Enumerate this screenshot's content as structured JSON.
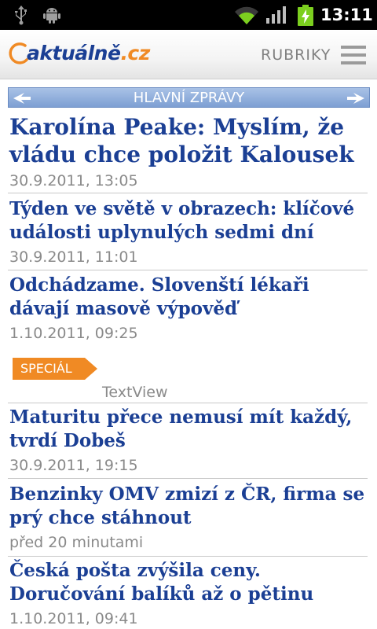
{
  "status_bar": {
    "time": "13:11",
    "icons": [
      "usb-icon",
      "android-debug-icon",
      "wifi-icon",
      "signal-icon",
      "battery-charging-icon"
    ]
  },
  "header": {
    "logo_text": "aktuálně",
    "logo_tld": ".cz",
    "menu_label": "RUBRIKY",
    "brand_color": "#1b3f94",
    "accent_color": "#f08a24"
  },
  "section": {
    "title": "HLAVNÍ ZPRÁVY",
    "bar_color": "#7d9fd3"
  },
  "articles": [
    {
      "headline": "Karolína Peake: Myslím, že vládu chce položit Kalousek",
      "meta": "30.9.2011, 13:05"
    },
    {
      "headline": "Týden ve světě v obrazech: klíčové události uplynulých sedmi dní",
      "meta": "30.9.2011, 11:01"
    },
    {
      "headline": "Odchádzame. Slovenští lékaři dávají masově výpověď",
      "meta": "1.10.2011, 09:25"
    },
    {
      "headline": "Maturitu přece nemusí mít každý, tvrdí Dobeš",
      "meta": "30.9.2011, 19:15"
    },
    {
      "headline": "Benzinky OMV zmizí z ČR, firma se prý chce stáhnout",
      "meta": "před 20 minutami"
    },
    {
      "headline": "Česká pošta zvýšila ceny. Doručování balíků až o pětinu",
      "meta": "1.10.2011, 09:41"
    }
  ],
  "special": {
    "label": "SPECIÁL",
    "placeholder_text": "TextView",
    "tag_color": "#f08a24"
  }
}
